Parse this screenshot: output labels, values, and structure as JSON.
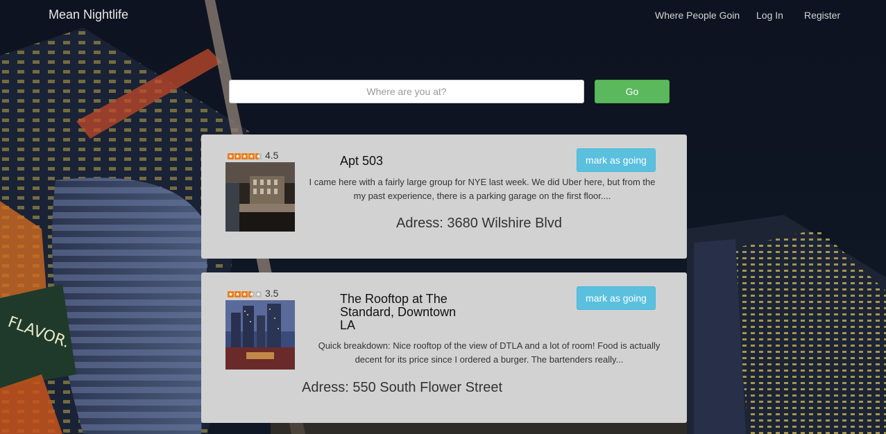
{
  "brand": "Mean Nightlife",
  "nav": {
    "where": "Where People Goin",
    "login": "Log In",
    "register": "Register"
  },
  "search": {
    "placeholder": "Where are you at?",
    "value": "",
    "go_label": "Go"
  },
  "colors": {
    "card_bg": "#d2d2d2",
    "go_button": "#5cb85c",
    "mark_button": "#5bc0de",
    "star": "#e97a16"
  },
  "venues": [
    {
      "rating": "4.5",
      "rating_value": 4.5,
      "name": "Apt 503",
      "mark_label": "mark as going",
      "description": "I came here with a fairly large group for NYE last week. We did Uber here, but from the my past experience, there is a parking garage on the first floor....",
      "address": "Adress: 3680 Wilshire Blvd"
    },
    {
      "rating": "3.5",
      "rating_value": 3.5,
      "name": "The Rooftop at The Standard, Downtown LA",
      "mark_label": "mark as going",
      "description": "Quick breakdown: Nice rooftop of the view of DTLA and a lot of room! Food is actually decent for its price since I ordered a burger. The bartenders really...",
      "address": "Adress: 550 South Flower Street"
    }
  ]
}
